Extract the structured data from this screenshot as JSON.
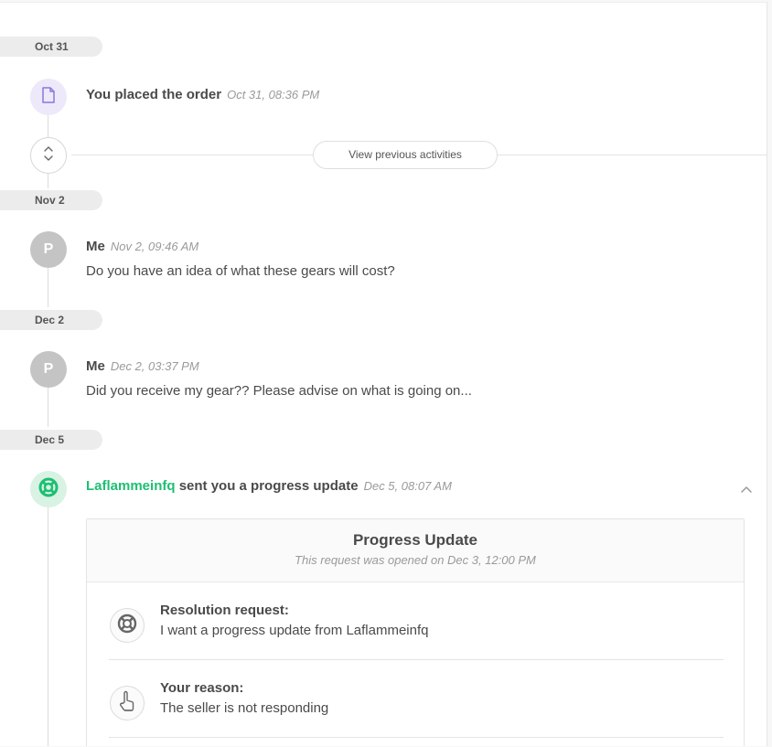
{
  "timeline": {
    "view_previous_label": "View previous activities",
    "groups": [
      {
        "date": "Oct 31",
        "activity": {
          "title": "You placed the order",
          "timestamp": "Oct 31, 08:36 PM",
          "icon": "document-icon"
        }
      },
      {
        "date": "Nov 2",
        "activity": {
          "avatar_letter": "P",
          "author": "Me",
          "timestamp": "Nov 2, 09:46 AM",
          "message": "Do you have an idea of what these gears will cost?"
        }
      },
      {
        "date": "Dec 2",
        "activity": {
          "avatar_letter": "P",
          "author": "Me",
          "timestamp": "Dec 2, 03:37 PM",
          "message": "Did you receive my gear?? Please advise on what is going on..."
        }
      },
      {
        "date": "Dec 5",
        "activity": {
          "seller": "Laflammeinfq",
          "title_suffix": "sent you a progress update",
          "timestamp": "Dec 5, 08:07 AM",
          "icon": "lifebuoy-icon"
        }
      }
    ]
  },
  "progress_card": {
    "title": "Progress Update",
    "subtitle": "This request was opened on Dec 3, 12:00 PM",
    "rows": [
      {
        "label": "Resolution request:",
        "value": "I want a progress update from Laflammeinfq",
        "icon": "lifebuoy-icon"
      },
      {
        "label": "Your reason:",
        "value": "The seller is not responding",
        "icon": "pointing-hand-icon"
      }
    ]
  },
  "colors": {
    "accent_green": "#1dbf73",
    "doc_icon_purple": "#8a79d8",
    "date_pill_bg": "#ececec"
  }
}
